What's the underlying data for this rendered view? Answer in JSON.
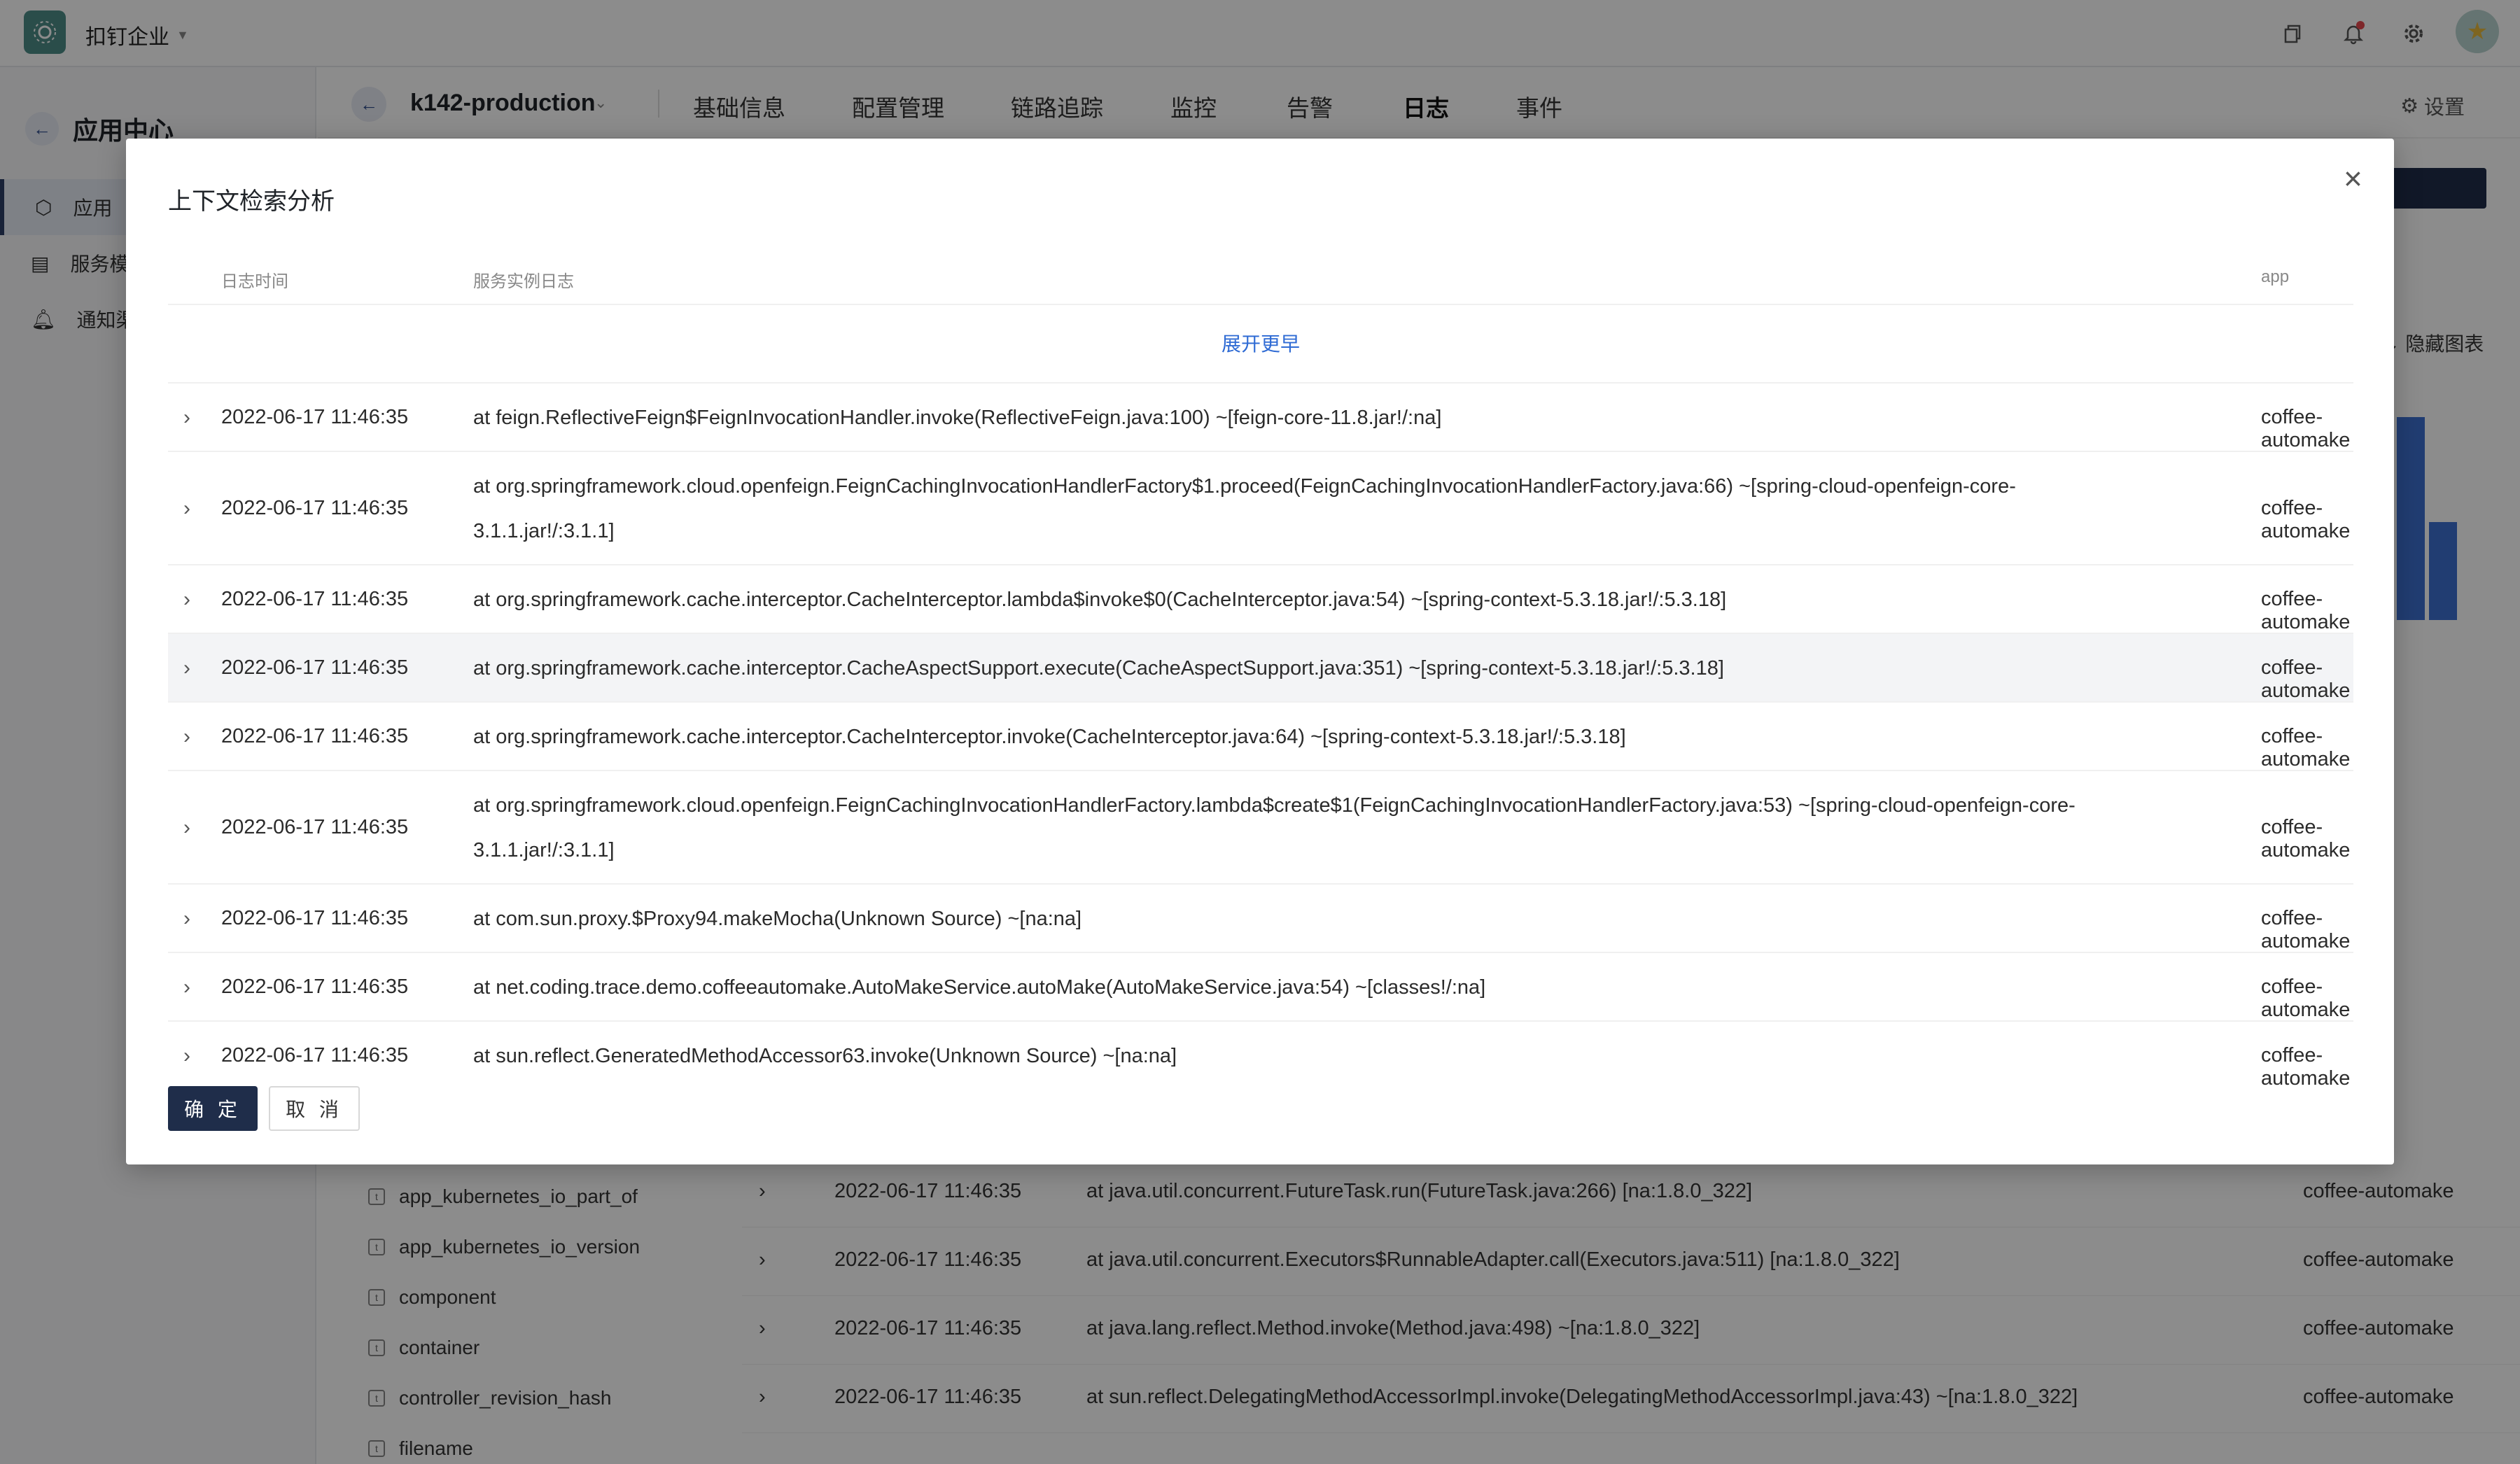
{
  "topbar": {
    "org_name": "扣钉企业",
    "icons": [
      "copy-icon",
      "bell-icon",
      "gear-icon"
    ]
  },
  "sidebar": {
    "title": "应用中心",
    "items": [
      {
        "label": "应用",
        "icon": "hexagon-icon",
        "active": true
      },
      {
        "label": "服务模",
        "icon": "table-icon",
        "active": false
      },
      {
        "label": "通知渠",
        "icon": "bell-icon",
        "active": false
      }
    ]
  },
  "appbar": {
    "app_name": "k142-production",
    "tabs": [
      "基础信息",
      "配置管理",
      "链路追踪",
      "监控",
      "告警",
      "日志",
      "事件"
    ],
    "active_tab": "日志",
    "settings_label": "设置"
  },
  "background": {
    "hide_chart_label": "隐藏图表",
    "fields": [
      "app_kubernetes_io_part_of",
      "app_kubernetes_io_version",
      "component",
      "container",
      "controller_revision_hash",
      "filename"
    ],
    "partial_app": "tomake",
    "rows": [
      {
        "time": "2022-06-17 11:46:35",
        "message": "at java.util.concurrent.FutureTask.run(FutureTask.java:266) [na:1.8.0_322]",
        "app": "coffee-automake"
      },
      {
        "time": "2022-06-17 11:46:35",
        "message": "at java.util.concurrent.Executors$RunnableAdapter.call(Executors.java:511) [na:1.8.0_322]",
        "app": "coffee-automake"
      },
      {
        "time": "2022-06-17 11:46:35",
        "message": "at java.lang.reflect.Method.invoke(Method.java:498) ~[na:1.8.0_322]",
        "app": "coffee-automake"
      },
      {
        "time": "2022-06-17 11:46:35",
        "message": "at sun.reflect.DelegatingMethodAccessorImpl.invoke(DelegatingMethodAccessorImpl.java:43) ~[na:1.8.0_322]",
        "app": "coffee-automake"
      }
    ]
  },
  "modal": {
    "title": "上下文检索分析",
    "columns": {
      "time": "日志时间",
      "log": "服务实例日志",
      "app": "app"
    },
    "expand_label": "展开更早",
    "ok_label": "确 定",
    "cancel_label": "取 消",
    "rows": [
      {
        "time": "2022-06-17 11:46:35",
        "message": "at feign.ReflectiveFeign$FeignInvocationHandler.invoke(ReflectiveFeign.java:100) ~[feign-core-11.8.jar!/:na]",
        "app": "coffee-automake"
      },
      {
        "time": "2022-06-17 11:46:35",
        "message": "at org.springframework.cloud.openfeign.FeignCachingInvocationHandlerFactory$1.proceed(FeignCachingInvocationHandlerFactory.java:66) ~[spring-cloud-openfeign-core-3.1.1.jar!/:3.1.1]",
        "app": "coffee-automake"
      },
      {
        "time": "2022-06-17 11:46:35",
        "message": "at org.springframework.cache.interceptor.CacheInterceptor.lambda$invoke$0(CacheInterceptor.java:54) ~[spring-context-5.3.18.jar!/:5.3.18]",
        "app": "coffee-automake"
      },
      {
        "time": "2022-06-17 11:46:35",
        "message": "at org.springframework.cache.interceptor.CacheAspectSupport.execute(CacheAspectSupport.java:351) ~[spring-context-5.3.18.jar!/:5.3.18]",
        "app": "coffee-automake"
      },
      {
        "time": "2022-06-17 11:46:35",
        "message": "at org.springframework.cache.interceptor.CacheInterceptor.invoke(CacheInterceptor.java:64) ~[spring-context-5.3.18.jar!/:5.3.18]",
        "app": "coffee-automake"
      },
      {
        "time": "2022-06-17 11:46:35",
        "message": "at org.springframework.cloud.openfeign.FeignCachingInvocationHandlerFactory.lambda$create$1(FeignCachingInvocationHandlerFactory.java:53) ~[spring-cloud-openfeign-core-3.1.1.jar!/:3.1.1]",
        "app": "coffee-automake"
      },
      {
        "time": "2022-06-17 11:46:35",
        "message": "at com.sun.proxy.$Proxy94.makeMocha(Unknown Source) ~[na:na]",
        "app": "coffee-automake"
      },
      {
        "time": "2022-06-17 11:46:35",
        "message": "at net.coding.trace.demo.coffeeautomake.AutoMakeService.autoMake(AutoMakeService.java:54) ~[classes!/:na]",
        "app": "coffee-automake"
      },
      {
        "time": "2022-06-17 11:46:35",
        "message": "at sun.reflect.GeneratedMethodAccessor63.invoke(Unknown Source) ~[na:na]",
        "app": "coffee-automake"
      }
    ]
  }
}
